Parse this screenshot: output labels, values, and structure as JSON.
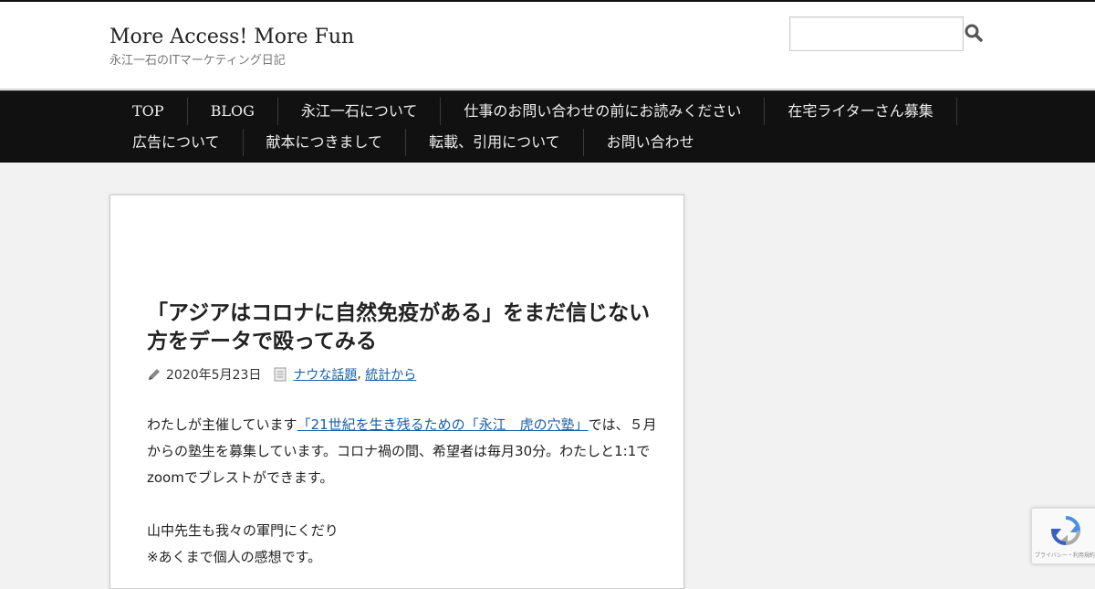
{
  "site": {
    "title": "More Access! More Fun",
    "description": "永江一石のITマーケティング日記"
  },
  "search": {
    "value": "",
    "placeholder": ""
  },
  "nav": {
    "row1": [
      "TOP",
      "BLOG",
      "永江一石について",
      "仕事のお問い合わせの前にお読みください",
      "在宅ライターさん募集"
    ],
    "row2": [
      "広告について",
      "献本につきまして",
      "転載、引用について",
      "お問い合わせ"
    ]
  },
  "post": {
    "title": "「アジアはコロナに自然免疫がある」をまだ信じない方をデータで殴ってみる",
    "date": "2020年5月23日",
    "categories": [
      "ナウな話題",
      "統計から"
    ],
    "category_separator": ",",
    "intro_before_link": "わたしが主催しています",
    "intro_link": "「21世紀を生き残るための「永江　虎の穴塾」",
    "intro_after_link": "では、５月からの塾生を募集しています。コロナ禍の間、希望者は毎月30分。わたしと1:1でzoomでブレストができます。",
    "line2": "山中先生も我々の軍門にくだり",
    "line3": "※あくまで個人の感想です。"
  },
  "recaptcha": {
    "text": "プライバシー・利用規約"
  },
  "colors": {
    "nav_bg": "#111111",
    "link": "#1a5fa8",
    "page_bg": "#f2f2f2"
  }
}
